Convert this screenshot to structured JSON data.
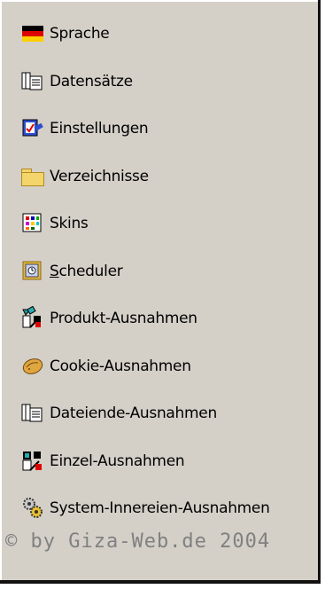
{
  "menu": {
    "items": [
      {
        "label": "Sprache",
        "icon": "german-flag-icon"
      },
      {
        "label": "Datensätze",
        "icon": "records-icon"
      },
      {
        "label": "Einstellungen",
        "icon": "settings-icon"
      },
      {
        "label": "Verzeichnisse",
        "icon": "folder-icon"
      },
      {
        "label": "Skins",
        "icon": "skins-icon"
      },
      {
        "label": "Scheduler",
        "icon": "scheduler-icon",
        "accel": "S"
      },
      {
        "label": "Produkt-Ausnahmen",
        "icon": "product-exceptions-icon"
      },
      {
        "label": "Cookie-Ausnahmen",
        "icon": "cookie-icon"
      },
      {
        "label": "Dateiende-Ausnahmen",
        "icon": "file-end-icon"
      },
      {
        "label": "Einzel-Ausnahmen",
        "icon": "single-exceptions-icon"
      },
      {
        "label": "System-Innereien-Ausnahmen",
        "icon": "system-gears-icon"
      }
    ]
  },
  "copyright": "© by Giza-Web.de 2004"
}
